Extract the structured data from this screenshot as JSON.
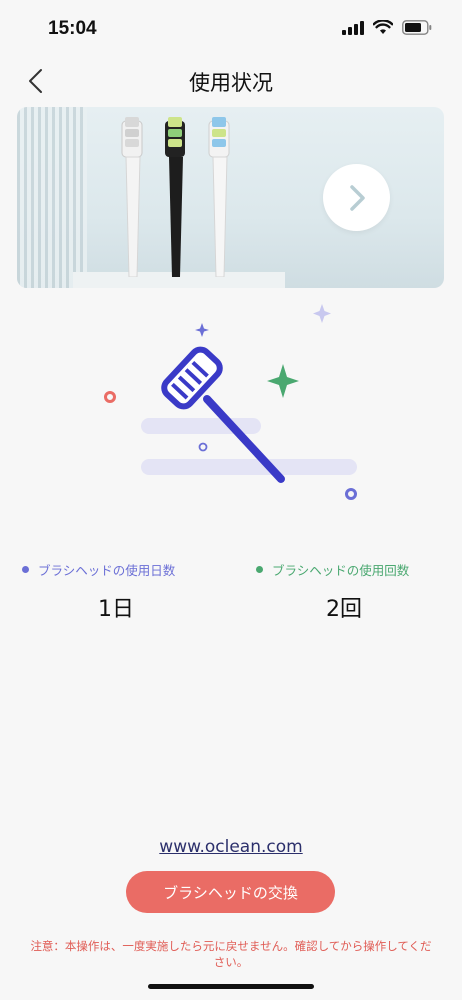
{
  "status_bar": {
    "time": "15:04",
    "signal_icon": "cellular-signal-icon",
    "wifi_icon": "wifi-icon",
    "battery_icon": "battery-icon"
  },
  "nav": {
    "title": "使用状况",
    "back_icon": "chevron-left-icon"
  },
  "banner": {
    "next_icon": "chevron-right-icon"
  },
  "stats": {
    "days": {
      "label": "ブラシヘッドの使用日数",
      "value": "1日",
      "color": "#6b6fd6"
    },
    "count": {
      "label": "ブラシヘッドの使用回数",
      "value": "2回",
      "color": "#4aa870"
    }
  },
  "footer": {
    "link": "www.oclean.com",
    "replace_button": "ブラシヘッドの交換",
    "note": "注意：本操作は、一度実施したら元に戻せません。確認してから操作してください。"
  },
  "colors": {
    "accent": "#ea6c65",
    "brush_blue": "#3a3ac7",
    "sparkle_green": "#4aa870"
  }
}
